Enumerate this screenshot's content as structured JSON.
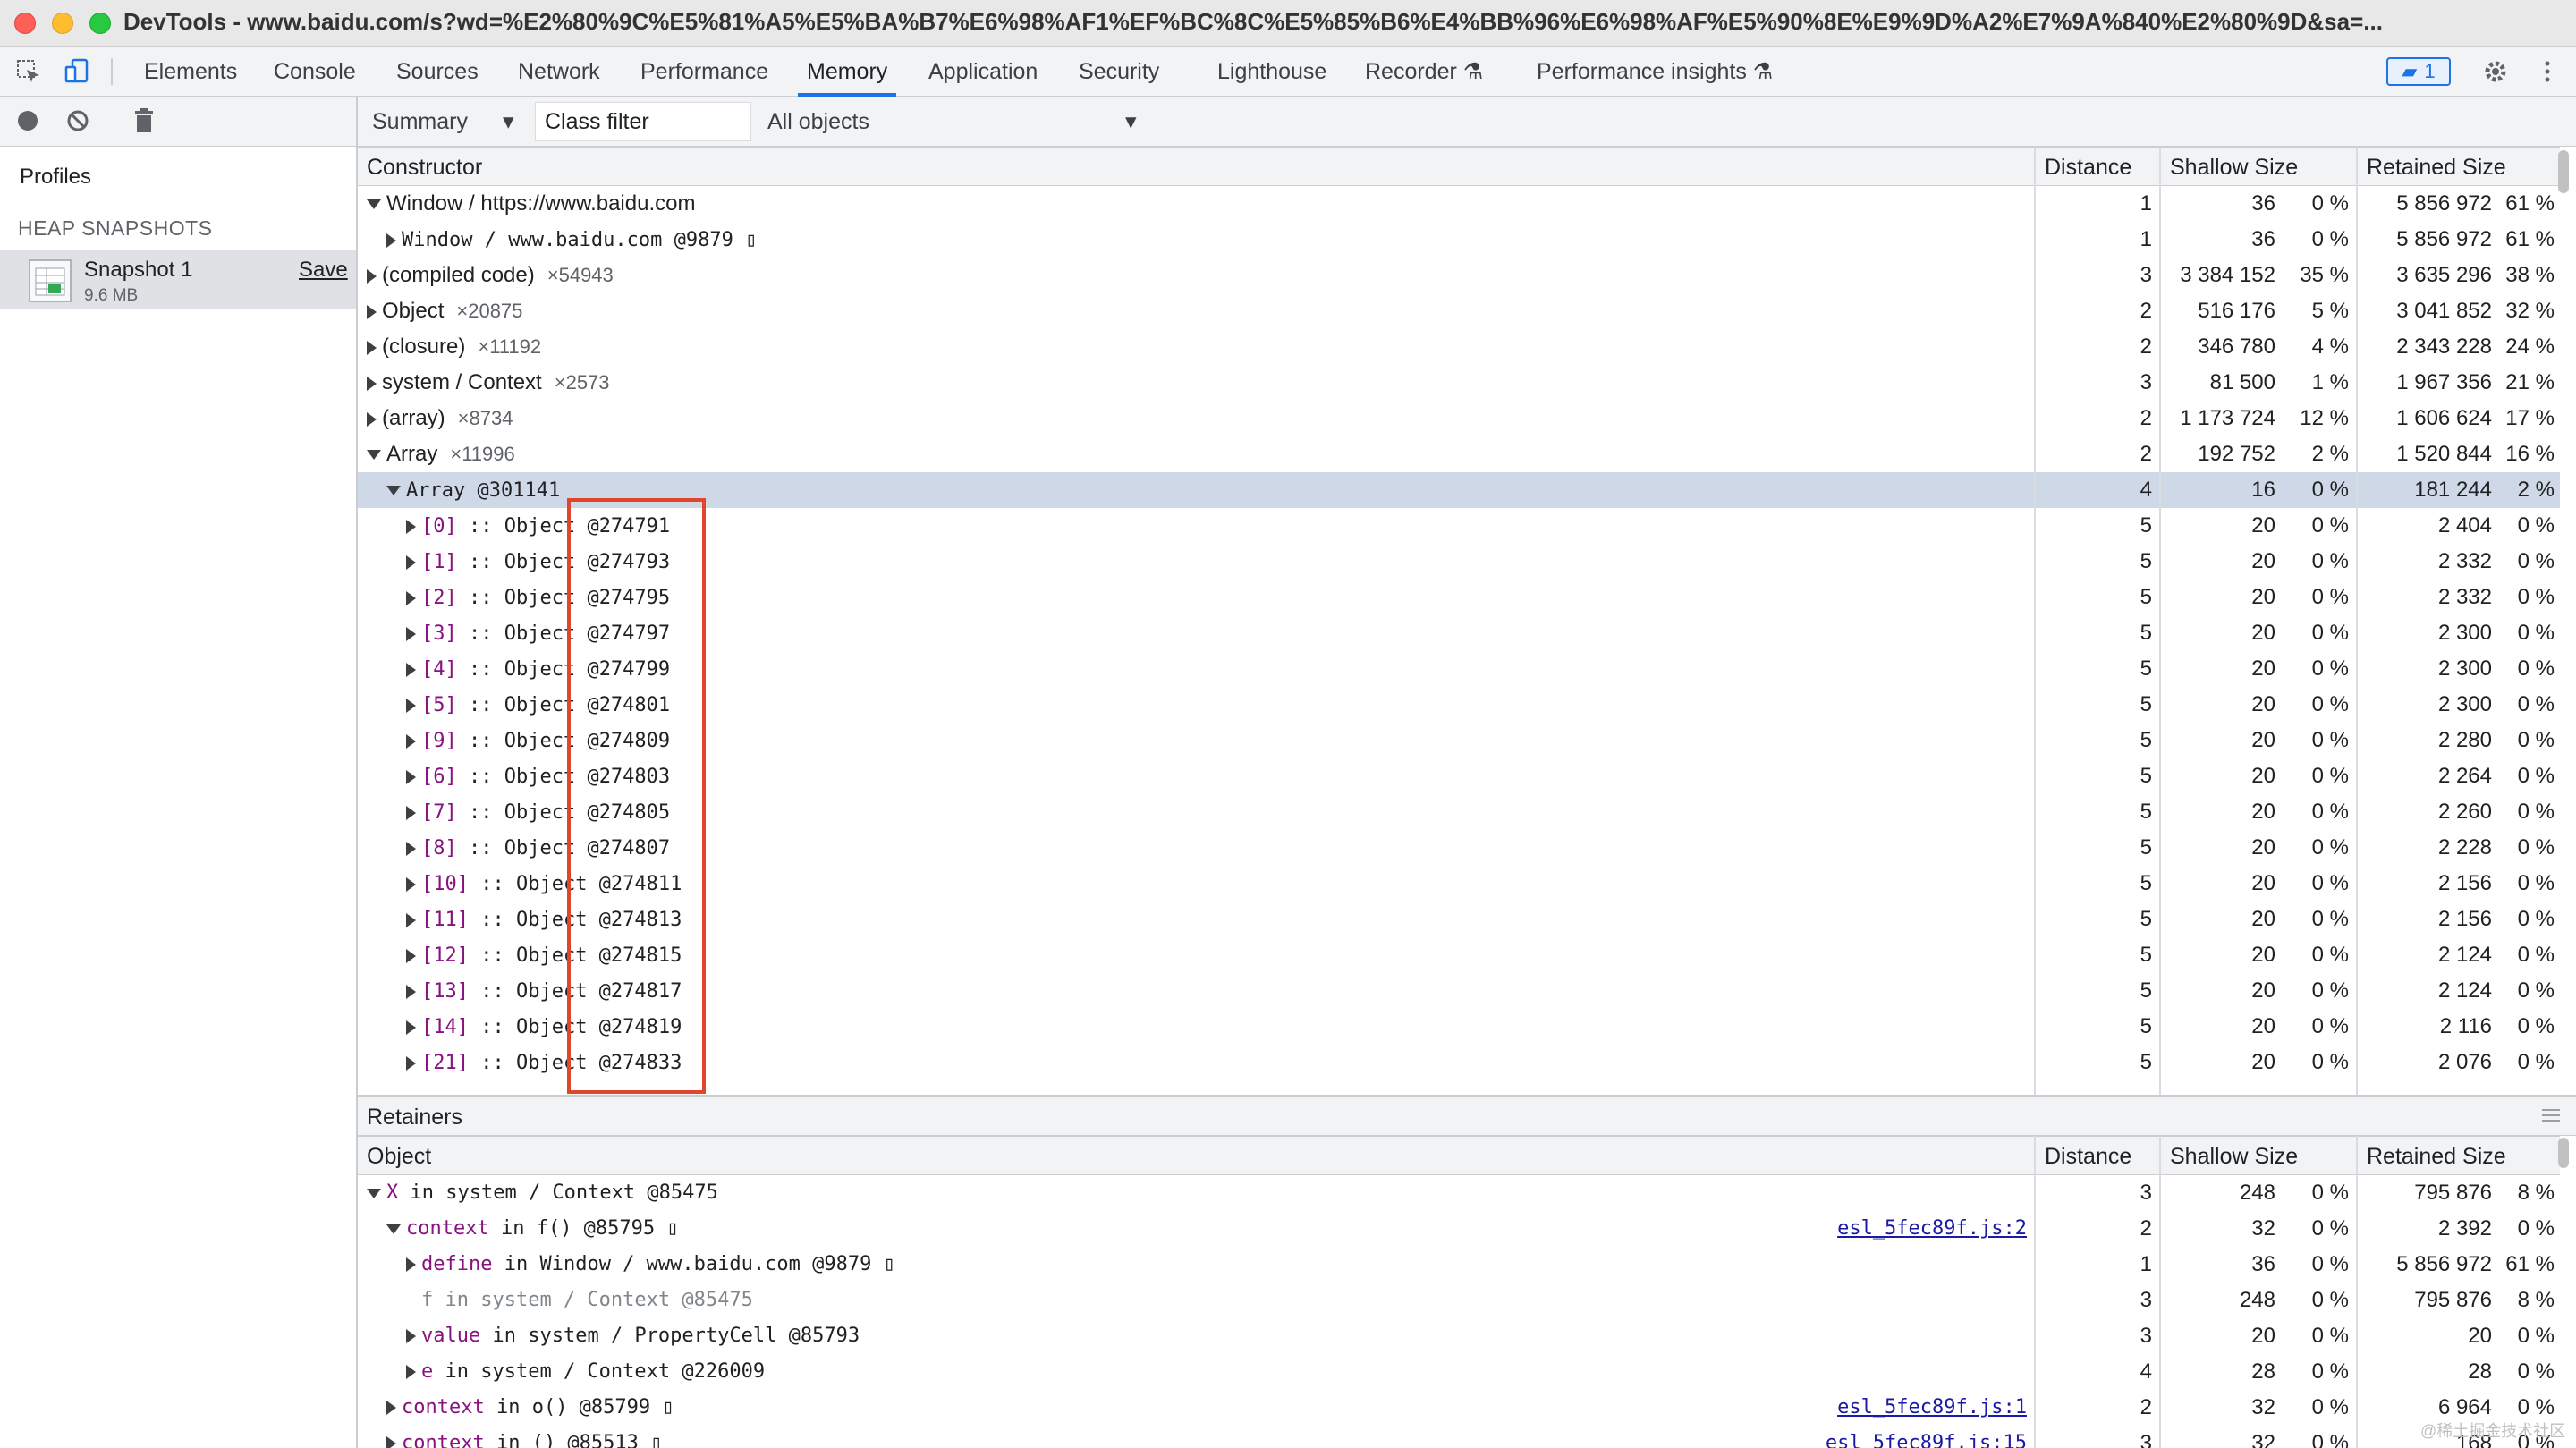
{
  "window": {
    "title": "DevTools - www.baidu.com/s?wd=%E2%80%9C%E5%81%A5%E5%BA%B7%E6%98%AF1%EF%BC%8C%E5%85%B6%E4%BB%96%E6%98%AF%E5%90%8E%E9%9D%A2%E7%9A%840%E2%80%9D&sa=..."
  },
  "tabs": [
    "Elements",
    "Console",
    "Sources",
    "Network",
    "Performance",
    "Memory",
    "Application",
    "Security",
    "Lighthouse",
    "Recorder",
    "Performance insights"
  ],
  "issues_count": "1",
  "toolbar": {
    "summary": "Summary",
    "class_filter": "Class filter",
    "all_objects": "All objects"
  },
  "sidebar": {
    "profiles": "Profiles",
    "section": "HEAP SNAPSHOTS",
    "snapshot_name": "Snapshot 1",
    "snapshot_size": "9.6 MB",
    "save": "Save"
  },
  "columns": {
    "constructor": "Constructor",
    "object": "Object",
    "distance": "Distance",
    "shallow": "Shallow Size",
    "retained": "Retained Size"
  },
  "rows": [
    {
      "ind": 0,
      "exp": "d",
      "name": "Window / https://www.baidu.com",
      "cnt": "",
      "mono": false,
      "dist": "1",
      "sh": "36",
      "shp": "0 %",
      "rt": "5 856 972",
      "rtp": "61 %"
    },
    {
      "ind": 1,
      "exp": "r",
      "name": "Window / www.baidu.com @9879 ▯",
      "cnt": "",
      "mono": true,
      "dist": "1",
      "sh": "36",
      "shp": "0 %",
      "rt": "5 856 972",
      "rtp": "61 %"
    },
    {
      "ind": 0,
      "exp": "r",
      "name": "(compiled code)",
      "cnt": "×54943",
      "mono": false,
      "dist": "3",
      "sh": "3 384 152",
      "shp": "35 %",
      "rt": "3 635 296",
      "rtp": "38 %"
    },
    {
      "ind": 0,
      "exp": "r",
      "name": "Object",
      "cnt": "×20875",
      "mono": false,
      "dist": "2",
      "sh": "516 176",
      "shp": "5 %",
      "rt": "3 041 852",
      "rtp": "32 %"
    },
    {
      "ind": 0,
      "exp": "r",
      "name": "(closure)",
      "cnt": "×11192",
      "mono": false,
      "dist": "2",
      "sh": "346 780",
      "shp": "4 %",
      "rt": "2 343 228",
      "rtp": "24 %"
    },
    {
      "ind": 0,
      "exp": "r",
      "name": "system / Context",
      "cnt": "×2573",
      "mono": false,
      "dist": "3",
      "sh": "81 500",
      "shp": "1 %",
      "rt": "1 967 356",
      "rtp": "21 %"
    },
    {
      "ind": 0,
      "exp": "r",
      "name": "(array)",
      "cnt": "×8734",
      "mono": false,
      "dist": "2",
      "sh": "1 173 724",
      "shp": "12 %",
      "rt": "1 606 624",
      "rtp": "17 %"
    },
    {
      "ind": 0,
      "exp": "d",
      "name": "Array",
      "cnt": "×11996",
      "mono": false,
      "dist": "2",
      "sh": "192 752",
      "shp": "2 %",
      "rt": "1 520 844",
      "rtp": "16 %"
    },
    {
      "ind": 1,
      "exp": "d",
      "name": "Array @301141",
      "cnt": "",
      "mono": true,
      "sel": true,
      "dist": "4",
      "sh": "16",
      "shp": "0 %",
      "rt": "181 244",
      "rtp": "2 %"
    },
    {
      "ind": 2,
      "exp": "r",
      "idx": "[0]",
      "name": " :: Object @274791",
      "mono": true,
      "dist": "5",
      "sh": "20",
      "shp": "0 %",
      "rt": "2 404",
      "rtp": "0 %"
    },
    {
      "ind": 2,
      "exp": "r",
      "idx": "[1]",
      "name": " :: Object @274793",
      "mono": true,
      "dist": "5",
      "sh": "20",
      "shp": "0 %",
      "rt": "2 332",
      "rtp": "0 %"
    },
    {
      "ind": 2,
      "exp": "r",
      "idx": "[2]",
      "name": " :: Object @274795",
      "mono": true,
      "dist": "5",
      "sh": "20",
      "shp": "0 %",
      "rt": "2 332",
      "rtp": "0 %"
    },
    {
      "ind": 2,
      "exp": "r",
      "idx": "[3]",
      "name": " :: Object @274797",
      "mono": true,
      "dist": "5",
      "sh": "20",
      "shp": "0 %",
      "rt": "2 300",
      "rtp": "0 %"
    },
    {
      "ind": 2,
      "exp": "r",
      "idx": "[4]",
      "name": " :: Object @274799",
      "mono": true,
      "dist": "5",
      "sh": "20",
      "shp": "0 %",
      "rt": "2 300",
      "rtp": "0 %"
    },
    {
      "ind": 2,
      "exp": "r",
      "idx": "[5]",
      "name": " :: Object @274801",
      "mono": true,
      "dist": "5",
      "sh": "20",
      "shp": "0 %",
      "rt": "2 300",
      "rtp": "0 %"
    },
    {
      "ind": 2,
      "exp": "r",
      "idx": "[9]",
      "name": " :: Object @274809",
      "mono": true,
      "dist": "5",
      "sh": "20",
      "shp": "0 %",
      "rt": "2 280",
      "rtp": "0 %"
    },
    {
      "ind": 2,
      "exp": "r",
      "idx": "[6]",
      "name": " :: Object @274803",
      "mono": true,
      "dist": "5",
      "sh": "20",
      "shp": "0 %",
      "rt": "2 264",
      "rtp": "0 %"
    },
    {
      "ind": 2,
      "exp": "r",
      "idx": "[7]",
      "name": " :: Object @274805",
      "mono": true,
      "dist": "5",
      "sh": "20",
      "shp": "0 %",
      "rt": "2 260",
      "rtp": "0 %"
    },
    {
      "ind": 2,
      "exp": "r",
      "idx": "[8]",
      "name": " :: Object @274807",
      "mono": true,
      "dist": "5",
      "sh": "20",
      "shp": "0 %",
      "rt": "2 228",
      "rtp": "0 %"
    },
    {
      "ind": 2,
      "exp": "r",
      "idx": "[10]",
      "name": " :: Object @274811",
      "mono": true,
      "dist": "5",
      "sh": "20",
      "shp": "0 %",
      "rt": "2 156",
      "rtp": "0 %"
    },
    {
      "ind": 2,
      "exp": "r",
      "idx": "[11]",
      "name": " :: Object @274813",
      "mono": true,
      "dist": "5",
      "sh": "20",
      "shp": "0 %",
      "rt": "2 156",
      "rtp": "0 %"
    },
    {
      "ind": 2,
      "exp": "r",
      "idx": "[12]",
      "name": " :: Object @274815",
      "mono": true,
      "dist": "5",
      "sh": "20",
      "shp": "0 %",
      "rt": "2 124",
      "rtp": "0 %"
    },
    {
      "ind": 2,
      "exp": "r",
      "idx": "[13]",
      "name": " :: Object @274817",
      "mono": true,
      "dist": "5",
      "sh": "20",
      "shp": "0 %",
      "rt": "2 124",
      "rtp": "0 %"
    },
    {
      "ind": 2,
      "exp": "r",
      "idx": "[14]",
      "name": " :: Object @274819",
      "mono": true,
      "dist": "5",
      "sh": "20",
      "shp": "0 %",
      "rt": "2 116",
      "rtp": "0 %"
    },
    {
      "ind": 2,
      "exp": "r",
      "idx": "[21]",
      "name": " :: Object @274833",
      "mono": true,
      "dist": "5",
      "sh": "20",
      "shp": "0 %",
      "rt": "2 076",
      "rtp": "0 %"
    }
  ],
  "retainers": {
    "title": "Retainers",
    "rows": [
      {
        "ind": 0,
        "exp": "d",
        "key": "X",
        "name": " in system / Context @85475",
        "link": "",
        "dist": "3",
        "sh": "248",
        "shp": "0 %",
        "rt": "795 876",
        "rtp": "8 %"
      },
      {
        "ind": 1,
        "exp": "d",
        "key": "context",
        "name": " in f() @85795 ▯",
        "link": "esl_5fec89f.js:2",
        "dist": "2",
        "sh": "32",
        "shp": "0 %",
        "rt": "2 392",
        "rtp": "0 %"
      },
      {
        "ind": 2,
        "exp": "r",
        "key": "define",
        "name": " in Window / www.baidu.com @9879 ▯",
        "link": "",
        "dist": "1",
        "sh": "36",
        "shp": "0 %",
        "rt": "5 856 972",
        "rtp": "61 %"
      },
      {
        "ind": 2,
        "exp": "n",
        "key": "f",
        "name": " in system / Context @85475",
        "link": "",
        "gray": true,
        "dist": "3",
        "sh": "248",
        "shp": "0 %",
        "rt": "795 876",
        "rtp": "8 %"
      },
      {
        "ind": 2,
        "exp": "r",
        "key": "value",
        "name": " in system / PropertyCell @85793",
        "link": "",
        "dist": "3",
        "sh": "20",
        "shp": "0 %",
        "rt": "20",
        "rtp": "0 %"
      },
      {
        "ind": 2,
        "exp": "r",
        "key": "e",
        "name": " in system / Context @226009",
        "link": "",
        "dist": "4",
        "sh": "28",
        "shp": "0 %",
        "rt": "28",
        "rtp": "0 %"
      },
      {
        "ind": 1,
        "exp": "r",
        "key": "context",
        "name": " in o() @85799 ▯",
        "link": "esl_5fec89f.js:1",
        "dist": "2",
        "sh": "32",
        "shp": "0 %",
        "rt": "6 964",
        "rtp": "0 %"
      },
      {
        "ind": 1,
        "exp": "r",
        "key": "context",
        "name": " in () @85513 ▯",
        "link": "esl_5fec89f.js:15",
        "dist": "3",
        "sh": "32",
        "shp": "0 %",
        "rt": "168",
        "rtp": "0 %"
      }
    ]
  },
  "watermark": "@稀土掘金技术社区"
}
